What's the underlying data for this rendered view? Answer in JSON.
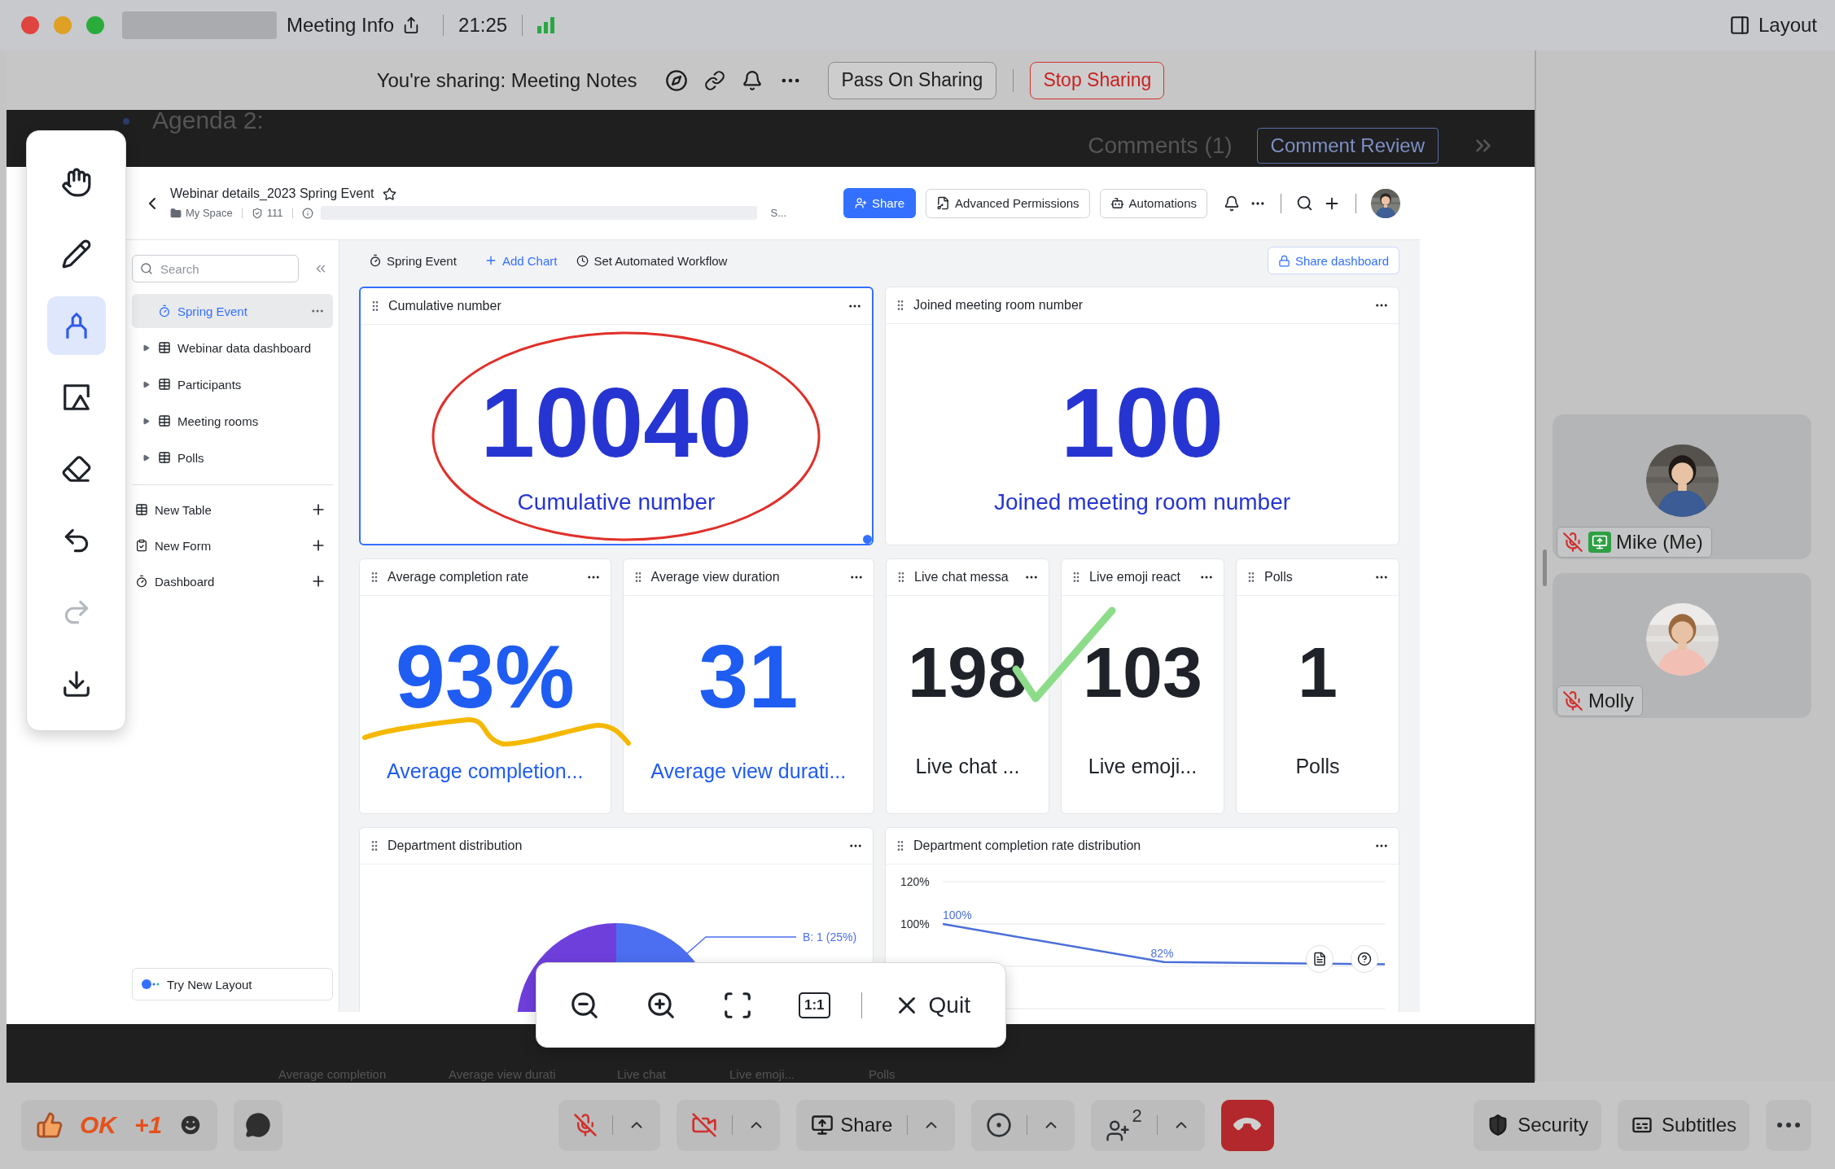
{
  "title_bar": {
    "title": "Meeting Info",
    "time": "21:25",
    "layout": "Layout"
  },
  "sharing_bar": {
    "status": "You're sharing: Meeting Notes",
    "pass_on": "Pass On Sharing",
    "stop": "Stop Sharing"
  },
  "shared_document": {
    "heading": "Agenda 2:",
    "comments": "Comments (1)",
    "comment_review": "Comment Review",
    "footer_labels": [
      "Average completion",
      "Average view durati",
      "Live chat",
      "Live emoji...",
      "Polls"
    ]
  },
  "annotation_tools": [
    {
      "kind": "hand",
      "selected": false,
      "disabled": false
    },
    {
      "kind": "pen",
      "selected": false,
      "disabled": false
    },
    {
      "kind": "marker",
      "selected": true,
      "disabled": false
    },
    {
      "kind": "shape",
      "selected": false,
      "disabled": false
    },
    {
      "kind": "eraser",
      "selected": false,
      "disabled": false
    },
    {
      "kind": "undo",
      "selected": false,
      "disabled": false
    },
    {
      "kind": "redo",
      "selected": false,
      "disabled": true
    },
    {
      "kind": "download",
      "selected": false,
      "disabled": false
    }
  ],
  "base_header": {
    "title": "Webinar details_2023 Spring Event",
    "space": "My Space",
    "count": "111",
    "truncated": "S...",
    "share": "Share",
    "permissions": "Advanced Permissions",
    "automations": "Automations"
  },
  "sidebar": {
    "search_placeholder": "Search",
    "items": [
      {
        "label": "Spring Event",
        "kind": "dashboard",
        "selected": true
      },
      {
        "label": "Webinar data dashboard",
        "kind": "table",
        "selected": false
      },
      {
        "label": "Participants",
        "kind": "table",
        "selected": false
      },
      {
        "label": "Meeting rooms",
        "kind": "table",
        "selected": false
      },
      {
        "label": "Polls",
        "kind": "table",
        "selected": false
      }
    ],
    "create_items": [
      {
        "label": "New Table",
        "kind": "table"
      },
      {
        "label": "New Form",
        "kind": "form"
      },
      {
        "label": "Dashboard",
        "kind": "dashboard"
      }
    ],
    "try_layout": "Try New Layout"
  },
  "dashboard": {
    "name": "Spring Event",
    "add_chart": "Add Chart",
    "workflow": "Set Automated Workflow",
    "share": "Share dashboard",
    "rows": [
      {
        "cards": [
          {
            "kind": "metric",
            "title": "Cumulative number",
            "value": "10040",
            "caption": "Cumulative number",
            "color": "#2635d1",
            "selected": true
          },
          {
            "kind": "metric",
            "title": "Joined meeting room number",
            "value": "100",
            "caption": "Joined meeting room number",
            "color": "#2635d1",
            "selected": false
          }
        ]
      },
      {
        "cards": [
          {
            "kind": "metric",
            "title": "Average completion rate",
            "value": "93%",
            "caption": "Average completion...",
            "color": "#1f5cf2",
            "selected": false
          },
          {
            "kind": "metric",
            "title": "Average view duration",
            "value": "31",
            "caption": "Average view durati...",
            "color": "#1f5cf2",
            "selected": false
          },
          {
            "kind": "metric",
            "title": "Live chat messa",
            "value": "198",
            "caption": "Live chat ...",
            "color": "#1f2329",
            "selected": false
          },
          {
            "kind": "metric",
            "title": "Live emoji react",
            "value": "103",
            "caption": "Live emoji...",
            "color": "#1f2329",
            "selected": false
          },
          {
            "kind": "metric",
            "title": "Polls",
            "value": "1",
            "caption": "Polls",
            "color": "#1f2329",
            "selected": false
          }
        ]
      },
      {
        "cards": [
          {
            "kind": "pie",
            "title": "Department distribution",
            "callout": "B: 1 (25%)",
            "selected": false
          },
          {
            "kind": "line",
            "title": "Department completion rate distribution",
            "selected": false,
            "chart_data": {
              "type": "line",
              "ylim": [
                60,
                120
              ],
              "yticks": [
                {
                  "value": 120,
                  "label": "120%"
                },
                {
                  "value": 100,
                  "label": "100%"
                }
              ],
              "series": [
                {
                  "color": "#4a6fd8",
                  "values": [
                    100,
                    82,
                    81
                  ]
                }
              ],
              "value_labels": [
                "100%",
                "82%",
                null
              ]
            }
          }
        ]
      }
    ]
  },
  "zoom_toolbar": {
    "ratio": "1:1",
    "quit": "Quit"
  },
  "participants": [
    {
      "name": "Mike (Me)",
      "muted": true,
      "sharing": true
    },
    {
      "name": "Molly",
      "muted": true,
      "sharing": false
    }
  ],
  "bottom_bar": {
    "reactions": [
      "OK",
      "+1"
    ],
    "mic": {
      "muted": true
    },
    "camera": {
      "on": false
    },
    "share": "Share",
    "participant_count": "2",
    "security": "Security",
    "subtitles": "Subtitles"
  }
}
